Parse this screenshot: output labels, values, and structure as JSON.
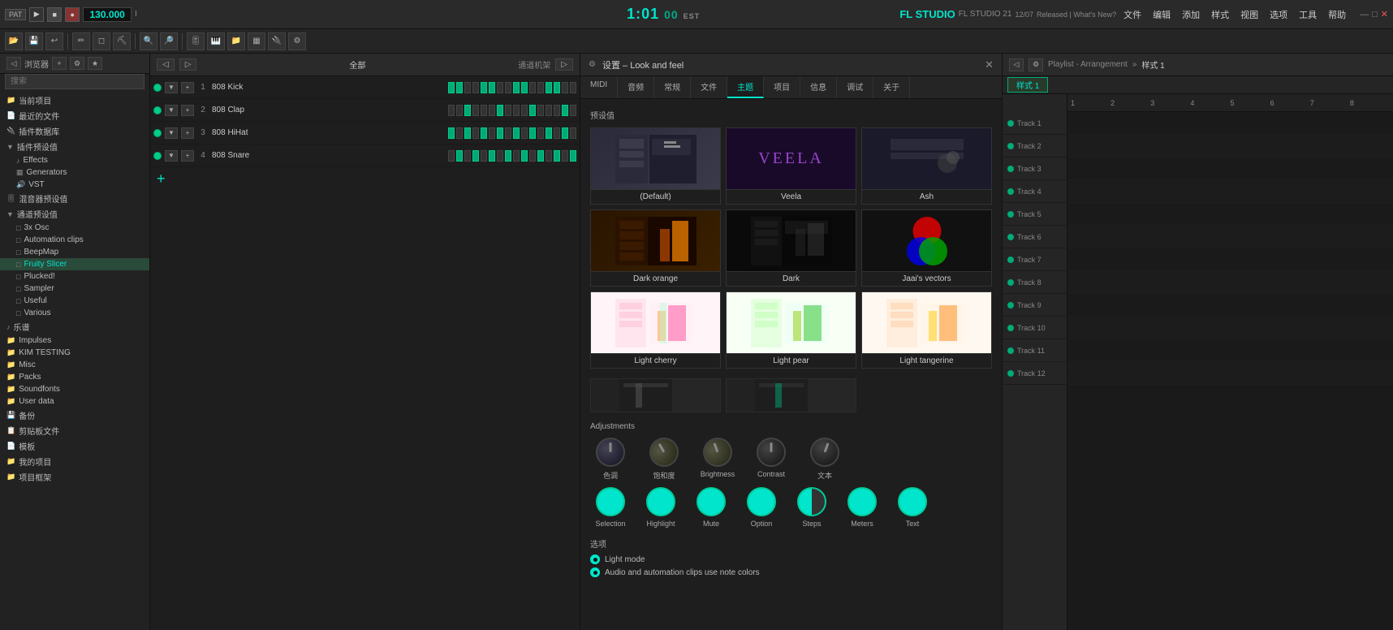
{
  "topbar": {
    "pat_label": "PAT",
    "bpm": "130.000",
    "vol_label": "I",
    "time": "1:01",
    "time_sub": "00",
    "est_label": "EST",
    "fl_studio_title": "FL STUDIO 21",
    "fl_released": "12/07",
    "fl_whatsnew": "Released | What's New?",
    "menu_items": [
      "文件",
      "编辑",
      "添加",
      "样式",
      "视图",
      "选项",
      "工具",
      "帮助"
    ],
    "window_controls": [
      "—",
      "□",
      "✕"
    ]
  },
  "settings": {
    "title": "设置 – Look and feel",
    "tabs": [
      "MIDI",
      "音频",
      "常规",
      "文件",
      "主题",
      "项目",
      "信息",
      "调试",
      "关于"
    ],
    "active_tab": "主题",
    "presets_label": "预设值",
    "presets": [
      {
        "name": "(Default)",
        "thumb": "default"
      },
      {
        "name": "Veela",
        "thumb": "veela"
      },
      {
        "name": "Ash",
        "thumb": "ash"
      },
      {
        "name": "Dark orange",
        "thumb": "dark-orange"
      },
      {
        "name": "Dark",
        "thumb": "dark"
      },
      {
        "name": "Jaai's vectors",
        "thumb": "jaai"
      },
      {
        "name": "Light cherry",
        "thumb": "light-cherry"
      },
      {
        "name": "Light pear",
        "thumb": "light-pear"
      },
      {
        "name": "Light tangerine",
        "thumb": "light-tangerine"
      },
      {
        "name": "...",
        "thumb": "more1"
      },
      {
        "name": "...",
        "thumb": "more2"
      }
    ],
    "adjustments_label": "Adjustments",
    "knobs": [
      {
        "label": "色调",
        "active": false
      },
      {
        "label": "饱和度",
        "active": false
      },
      {
        "label": "Brightness",
        "active": false
      },
      {
        "label": "Contrast",
        "active": false
      },
      {
        "label": "文本",
        "active": false
      }
    ],
    "circles": [
      {
        "label": "Selection",
        "color": "full"
      },
      {
        "label": "Highlight",
        "color": "full"
      },
      {
        "label": "Mute",
        "color": "full"
      },
      {
        "label": "Option",
        "color": "full"
      },
      {
        "label": "Steps",
        "color": "half"
      },
      {
        "label": "Meters",
        "color": "full"
      },
      {
        "label": "Text",
        "color": "full"
      }
    ],
    "options_label": "选项",
    "options": [
      {
        "text": "Light mode",
        "selected": true
      },
      {
        "text": "Audio and automation clips use note colors",
        "selected": true
      }
    ]
  },
  "sidebar": {
    "search_placeholder": "搜索",
    "items": [
      {
        "label": "当前项目",
        "indent": 0,
        "icon": "📁"
      },
      {
        "label": "最近的文件",
        "indent": 0,
        "icon": "📄"
      },
      {
        "label": "插件数据库",
        "indent": 0,
        "icon": "🔌"
      },
      {
        "label": "插件预设值",
        "indent": 0,
        "icon": "📦",
        "expanded": true
      },
      {
        "label": "Effects",
        "indent": 1,
        "icon": "♪"
      },
      {
        "label": "Generators",
        "indent": 1,
        "icon": "▦"
      },
      {
        "label": "VST",
        "indent": 1,
        "icon": "🔊"
      },
      {
        "label": "混音器预设值",
        "indent": 0,
        "icon": "🎚"
      },
      {
        "label": "通道预设值",
        "indent": 0,
        "icon": "📊",
        "expanded": true
      },
      {
        "label": "3x Osc",
        "indent": 1,
        "icon": "□"
      },
      {
        "label": "Automation clips",
        "indent": 1,
        "icon": "□"
      },
      {
        "label": "BeepMap",
        "indent": 1,
        "icon": "□"
      },
      {
        "label": "Fruity Slicer",
        "indent": 1,
        "icon": "□",
        "selected": true
      },
      {
        "label": "Plucked!",
        "indent": 1,
        "icon": "□"
      },
      {
        "label": "Sampler",
        "indent": 1,
        "icon": "□"
      },
      {
        "label": "Useful",
        "indent": 1,
        "icon": "□"
      },
      {
        "label": "Various",
        "indent": 1,
        "icon": "□"
      },
      {
        "label": "乐谱",
        "indent": 0,
        "icon": "♪"
      },
      {
        "label": "Impulses",
        "indent": 0,
        "icon": "📁"
      },
      {
        "label": "KIM TESTING",
        "indent": 0,
        "icon": "📁"
      },
      {
        "label": "Misc",
        "indent": 0,
        "icon": "📁"
      },
      {
        "label": "Packs",
        "indent": 0,
        "icon": "📁"
      },
      {
        "label": "Soundfonts",
        "indent": 0,
        "icon": "📁"
      },
      {
        "label": "User data",
        "indent": 0,
        "icon": "📁"
      },
      {
        "label": "备份",
        "indent": 0,
        "icon": "💾"
      },
      {
        "label": "剪贴板文件",
        "indent": 0,
        "icon": "📋"
      },
      {
        "label": "模板",
        "indent": 0,
        "icon": "📄"
      },
      {
        "label": "我的项目",
        "indent": 0,
        "icon": "📁"
      },
      {
        "label": "项目框架",
        "indent": 0,
        "icon": "📁"
      }
    ]
  },
  "channel_rack": {
    "title": "全部",
    "frame_title": "通道机架",
    "channels": [
      {
        "num": "1",
        "name": "808 Kick",
        "steps": [
          1,
          1,
          0,
          0,
          1,
          1,
          0,
          0,
          1,
          1,
          0,
          0,
          1,
          1,
          0,
          0
        ]
      },
      {
        "num": "2",
        "name": "808 Clap",
        "steps": [
          0,
          0,
          1,
          0,
          0,
          0,
          1,
          0,
          0,
          0,
          1,
          0,
          0,
          0,
          1,
          0
        ]
      },
      {
        "num": "3",
        "name": "808 HiHat",
        "steps": [
          1,
          0,
          1,
          0,
          1,
          0,
          1,
          0,
          1,
          0,
          1,
          0,
          1,
          0,
          1,
          0
        ]
      },
      {
        "num": "4",
        "name": "808 Snare",
        "steps": [
          0,
          1,
          0,
          1,
          0,
          1,
          0,
          1,
          0,
          1,
          0,
          1,
          0,
          1,
          0,
          1
        ]
      }
    ]
  },
  "playlist": {
    "title": "Playlist - Arrangement",
    "style_label": "样式 1",
    "pattern_label": "样式 1",
    "tracks": [
      "Track 1",
      "Track 2",
      "Track 3",
      "Track 4",
      "Track 5",
      "Track 6",
      "Track 7",
      "Track 8",
      "Track 9",
      "Track 10",
      "Track 11",
      "Track 12"
    ],
    "ruler_marks": [
      "1",
      "2",
      "3",
      "4",
      "5",
      "6",
      "7",
      "8"
    ]
  },
  "colors": {
    "accent": "#00e5cc",
    "bg_dark": "#1a1a1a",
    "bg_medium": "#252525",
    "bg_light": "#2a2a2a",
    "text_main": "#cccccc",
    "text_dim": "#888888"
  }
}
